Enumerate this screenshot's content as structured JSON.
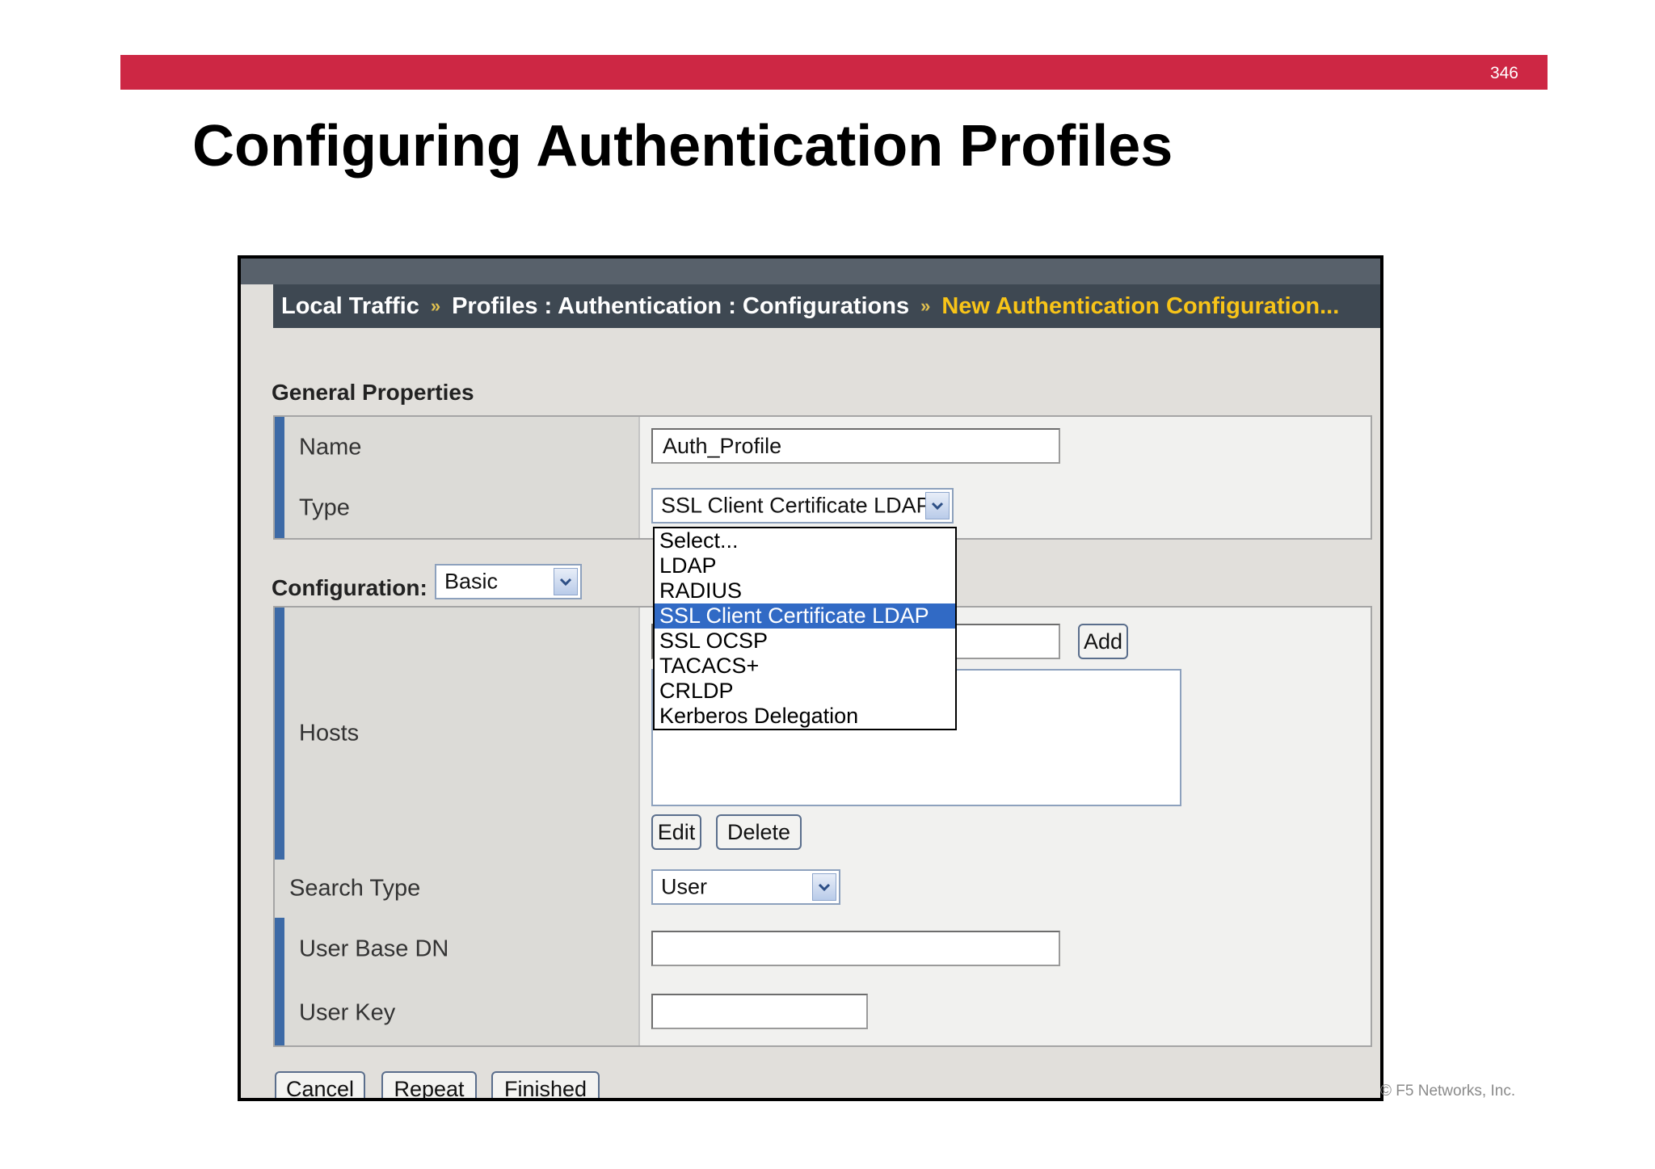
{
  "slide": {
    "page_number": "346",
    "title": "Configuring Authentication Profiles",
    "footer": "© F5 Networks, Inc."
  },
  "breadcrumb": {
    "item1": "Local Traffic",
    "separator": "»",
    "item2": "Profiles : Authentication : Configurations",
    "item3": "New Authentication Configuration..."
  },
  "general": {
    "section_title": "General Properties",
    "name_label": "Name",
    "name_value": "Auth_Profile",
    "type_label": "Type",
    "type_value": "SSL Client Certificate LDAP",
    "type_options": [
      "Select...",
      "LDAP",
      "RADIUS",
      "SSL Client Certificate LDAP",
      "SSL OCSP",
      "TACACS+",
      "CRLDP",
      "Kerberos Delegation"
    ],
    "type_selected_index": 3
  },
  "configuration": {
    "label": "Configuration:",
    "mode_value": "Basic",
    "hosts_label": "Hosts",
    "add_button": "Add",
    "edit_button": "Edit",
    "delete_button": "Delete",
    "search_type_label": "Search Type",
    "search_type_value": "User",
    "user_base_dn_label": "User Base DN",
    "user_base_dn_value": "",
    "user_key_label": "User Key",
    "user_key_value": ""
  },
  "actions": {
    "cancel": "Cancel",
    "repeat": "Repeat",
    "finished": "Finished"
  },
  "colors": {
    "accent_bar": "#cd2744",
    "required_marker": "#3d6aa6",
    "breadcrumb_highlight": "#f8c418",
    "selection": "#316ac5"
  },
  "icons": {
    "dropdown_arrow": "chevron-down-icon",
    "breadcrumb_separator": "double-chevron-right-icon"
  }
}
